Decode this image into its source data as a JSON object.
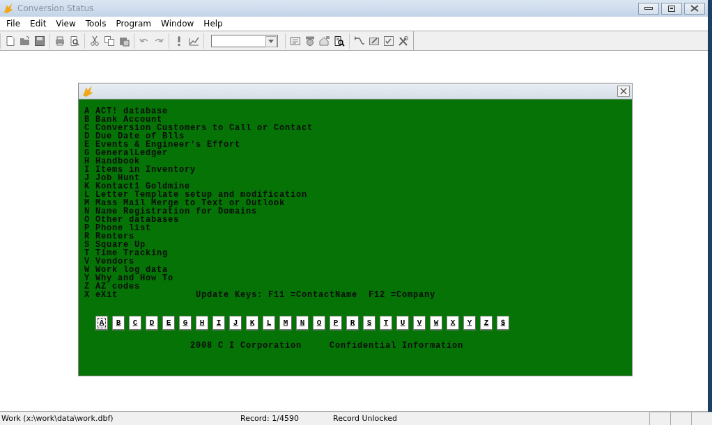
{
  "window": {
    "title": "Conversion Status"
  },
  "menu": [
    "File",
    "Edit",
    "View",
    "Tools",
    "Program",
    "Window",
    "Help"
  ],
  "child_window": {
    "menu_items": [
      {
        "key": "A",
        "label": "ACT! database"
      },
      {
        "key": "B",
        "label": "Bank Account"
      },
      {
        "key": "C",
        "label": "Conversion Customers to Call or Contact"
      },
      {
        "key": "D",
        "label": "Due Date of Blls"
      },
      {
        "key": "E",
        "label": "Events & Engineer's Effort"
      },
      {
        "key": "G",
        "label": "GeneralLedger"
      },
      {
        "key": "H",
        "label": "Handbook"
      },
      {
        "key": "I",
        "label": "Items in Inventory"
      },
      {
        "key": "J",
        "label": "Job Hunt"
      },
      {
        "key": "K",
        "label": "Kontact1 Goldmine"
      },
      {
        "key": "L",
        "label": "Letter Template setup and modification"
      },
      {
        "key": "M",
        "label": "Mass Mail Merge to Text or Outlook"
      },
      {
        "key": "N",
        "label": "Name Registration for Domains"
      },
      {
        "key": "O",
        "label": "Other databases"
      },
      {
        "key": "P",
        "label": "Phone list"
      },
      {
        "key": "R",
        "label": "Renters"
      },
      {
        "key": "S",
        "label": "Square Up"
      },
      {
        "key": "T",
        "label": "Time Tracking"
      },
      {
        "key": "V",
        "label": "Vendors"
      },
      {
        "key": "W",
        "label": "Work log data"
      },
      {
        "key": "Y",
        "label": "Why and How To"
      },
      {
        "key": "Z",
        "label": "AZ codes"
      },
      {
        "key": "X",
        "label": "eXit"
      }
    ],
    "update_keys": "Update Keys: F11 =ContactName  F12 =Company",
    "letter_buttons": [
      {
        "label": "A",
        "selected": true
      },
      {
        "label": "B",
        "selected": false
      },
      {
        "label": "C",
        "selected": false
      },
      {
        "label": "D",
        "selected": false
      },
      {
        "label": "E",
        "selected": false
      },
      {
        "label": "G",
        "selected": false
      },
      {
        "label": "H",
        "selected": false
      },
      {
        "label": "I",
        "selected": false
      },
      {
        "label": "J",
        "selected": false
      },
      {
        "label": "K",
        "selected": false
      },
      {
        "label": "L",
        "selected": false
      },
      {
        "label": "M",
        "selected": false
      },
      {
        "label": "N",
        "selected": false
      },
      {
        "label": "O",
        "selected": false
      },
      {
        "label": "P",
        "selected": false
      },
      {
        "label": "R",
        "selected": false
      },
      {
        "label": "S",
        "selected": false
      },
      {
        "label": "T",
        "selected": false
      },
      {
        "label": "U",
        "selected": false
      },
      {
        "label": "V",
        "selected": false
      },
      {
        "label": "W",
        "selected": false
      },
      {
        "label": "X",
        "selected": false
      },
      {
        "label": "Y",
        "selected": false
      },
      {
        "label": "Z",
        "selected": false
      },
      {
        "label": "$",
        "selected": false
      }
    ],
    "footer": "2008 C I Corporation     Confidential Information"
  },
  "status_bar": {
    "file": "Work (x:\\work\\data\\work.dbf)",
    "record": "Record: 1/4590",
    "lock": "Record Unlocked"
  }
}
